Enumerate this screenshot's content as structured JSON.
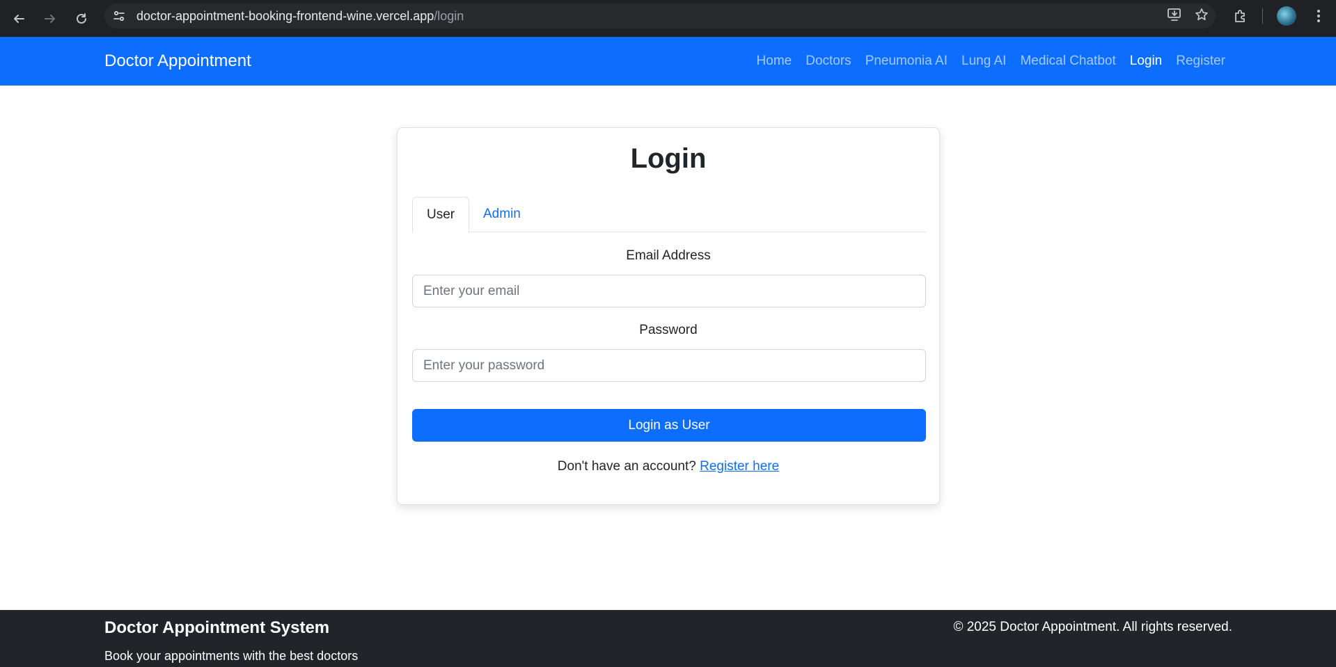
{
  "browser": {
    "url_host": "doctor-appointment-booking-frontend-wine.vercel.app",
    "url_path": "/login",
    "icons": [
      "back-arrow-icon",
      "forward-arrow-icon",
      "reload-icon",
      "site-info-icon",
      "install-app-icon",
      "star-icon",
      "extensions-icon",
      "profile-avatar",
      "kebab-menu-icon"
    ]
  },
  "navbar": {
    "brand": "Doctor Appointment",
    "links": [
      {
        "label": "Home",
        "active": false
      },
      {
        "label": "Doctors",
        "active": false
      },
      {
        "label": "Pneumonia AI",
        "active": false
      },
      {
        "label": "Lung AI",
        "active": false
      },
      {
        "label": "Medical Chatbot",
        "active": false
      },
      {
        "label": "Login",
        "active": true
      },
      {
        "label": "Register",
        "active": false
      }
    ]
  },
  "login": {
    "title": "Login",
    "tabs": [
      {
        "label": "User",
        "active": true
      },
      {
        "label": "Admin",
        "active": false
      }
    ],
    "email_label": "Email Address",
    "email_placeholder": "Enter your email",
    "email_value": "",
    "password_label": "Password",
    "password_placeholder": "Enter your password",
    "password_value": "",
    "submit_label": "Login as User",
    "no_account_text": "Don't have an account?",
    "register_link": "Register here"
  },
  "footer": {
    "title": "Doctor Appointment System",
    "subtitle": "Book your appointments with the best doctors",
    "copyright": "© 2025 Doctor Appointment. All rights reserved."
  },
  "colors": {
    "primary": "#0d6efd",
    "footer_bg": "#212529",
    "chrome_bg": "#202124"
  }
}
